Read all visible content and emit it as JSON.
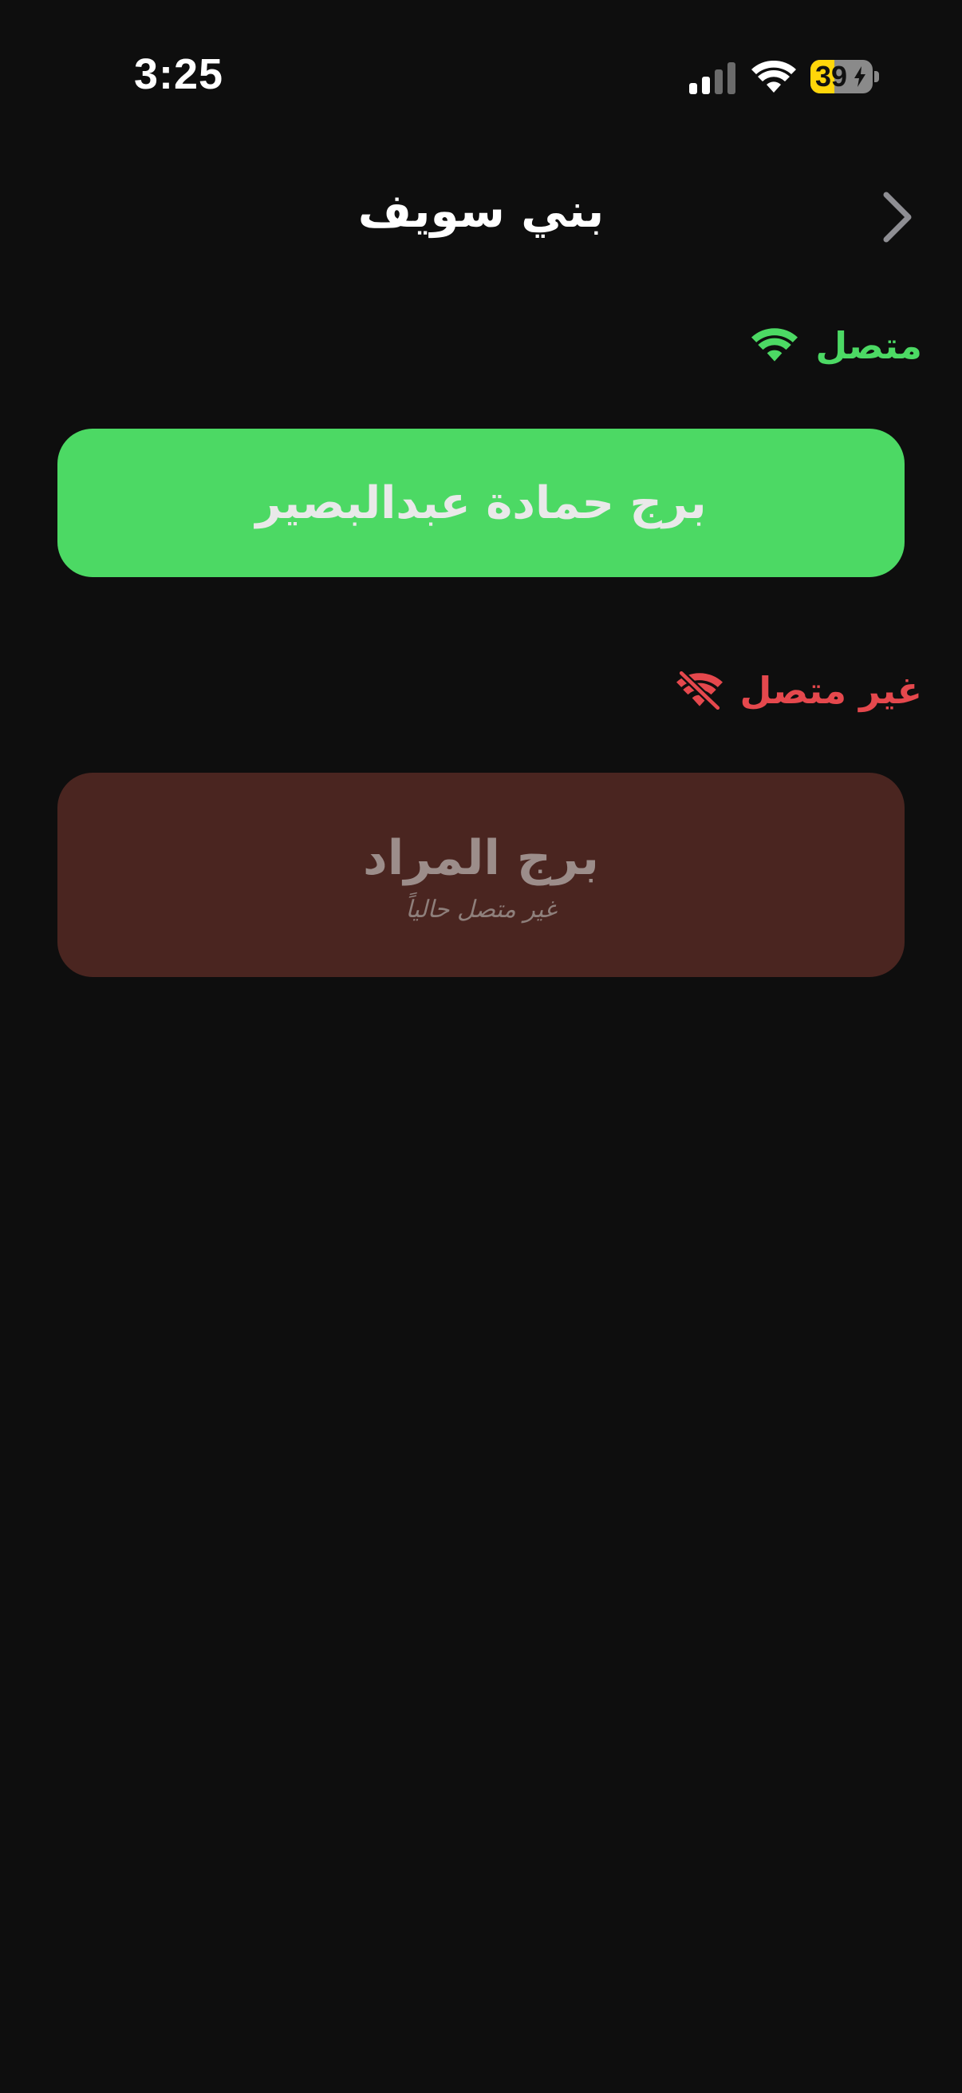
{
  "status_bar": {
    "time": "3:25",
    "battery_level": "39",
    "battery_percent": 39,
    "signal_bars": 2,
    "signal_bars_total": 4,
    "colors": {
      "battery_fill": "#ffd60a",
      "battery_body": "#8a8a8a"
    }
  },
  "header": {
    "title": "بني سويف",
    "back_icon": "chevron-right-icon"
  },
  "online_section": {
    "label": "متصل",
    "icon": "wifi-icon",
    "color": "#4cd964",
    "towers": [
      {
        "name": "برج حمادة عبدالبصير"
      }
    ]
  },
  "offline_section": {
    "label": "غير متصل",
    "icon": "wifi-off-icon",
    "color": "#e5484d",
    "towers": [
      {
        "name": "برج المراد",
        "status": "غير متصل حالياً"
      }
    ]
  }
}
